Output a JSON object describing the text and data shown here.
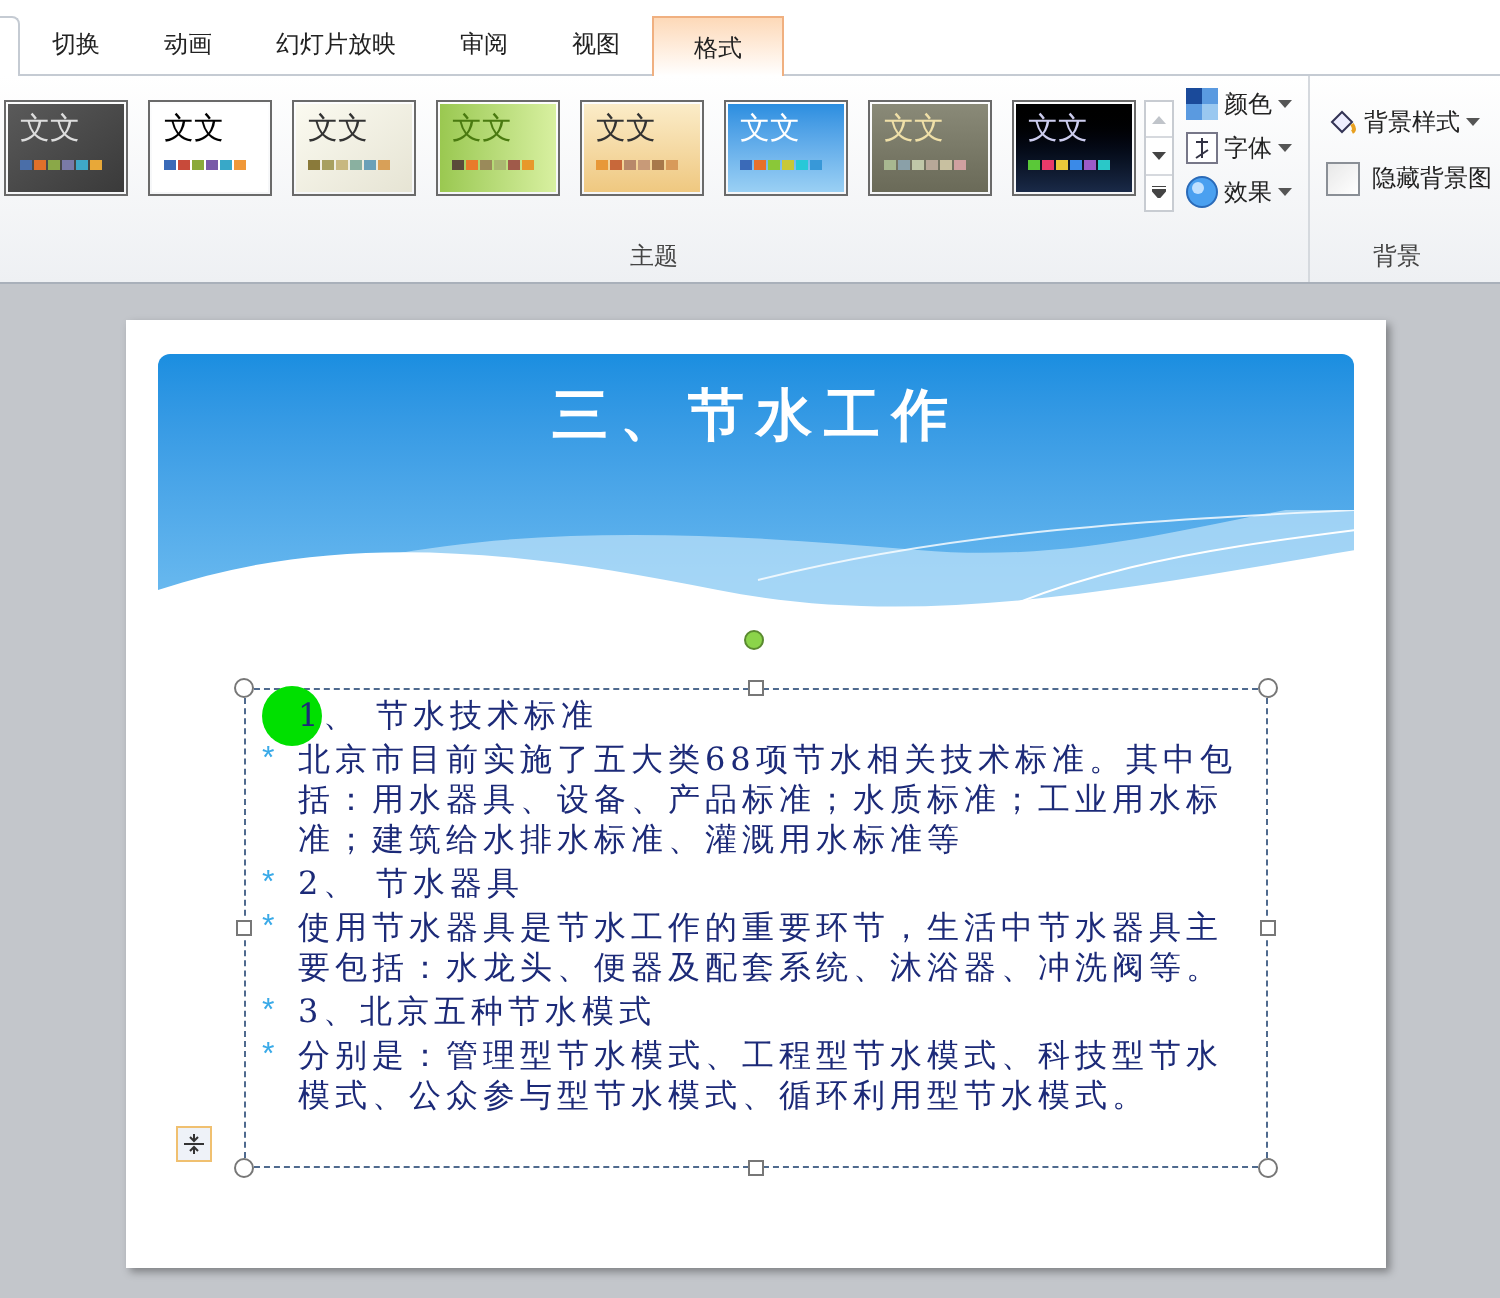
{
  "ribbon": {
    "tabs": [
      {
        "label": "切换",
        "selected": false
      },
      {
        "label": "动画",
        "selected": false
      },
      {
        "label": "幻灯片放映",
        "selected": false
      },
      {
        "label": "审阅",
        "selected": false
      },
      {
        "label": "视图",
        "selected": false
      },
      {
        "label": "格式",
        "selected": true
      }
    ],
    "themes": [
      {
        "label": "文文",
        "kind": "dark"
      },
      {
        "label": "文文",
        "kind": "white"
      },
      {
        "label": "文文",
        "kind": "cream"
      },
      {
        "label": "文文",
        "kind": "green"
      },
      {
        "label": "文文",
        "kind": "tan"
      },
      {
        "label": "文文",
        "kind": "blue"
      },
      {
        "label": "文文",
        "kind": "olive"
      },
      {
        "label": "文文",
        "kind": "black"
      }
    ],
    "theme_options": [
      {
        "label": "颜色",
        "kind": "colors"
      },
      {
        "label": "字体",
        "kind": "fonts"
      },
      {
        "label": "效果",
        "kind": "effects"
      }
    ],
    "themes_group_label": "主题",
    "background_style": "背景样式",
    "hide_background": {
      "label": "隐藏背景图",
      "checked": false
    },
    "background_group_label": "背景"
  },
  "slide": {
    "title": "三、节水工作",
    "items": [
      {
        "text": "1、 节水技术标准"
      },
      {
        "text": "北京市目前实施了五大类68项节水相关技术标准。其中包括：用水器具、设备、产品标准；水质标准；工业用水标准；建筑给水排水标准、灌溉用水标准等",
        "bullet": "*"
      },
      {
        "text": "2、 节水器具",
        "bullet": "*"
      },
      {
        "text": "使用节水器具是节水工作的重要环节，生活中节水器具主要包括：水龙头、便器及配套系统、沐浴器、冲洗阀等。",
        "bullet": "*"
      },
      {
        "text": "3、北京五种节水模式",
        "bullet": "*"
      },
      {
        "text": "分别是：管理型节水模式、工程型节水模式、科技型节水模式、公众参与型节水模式、循环利用型节水模式。",
        "bullet": "*"
      }
    ]
  }
}
